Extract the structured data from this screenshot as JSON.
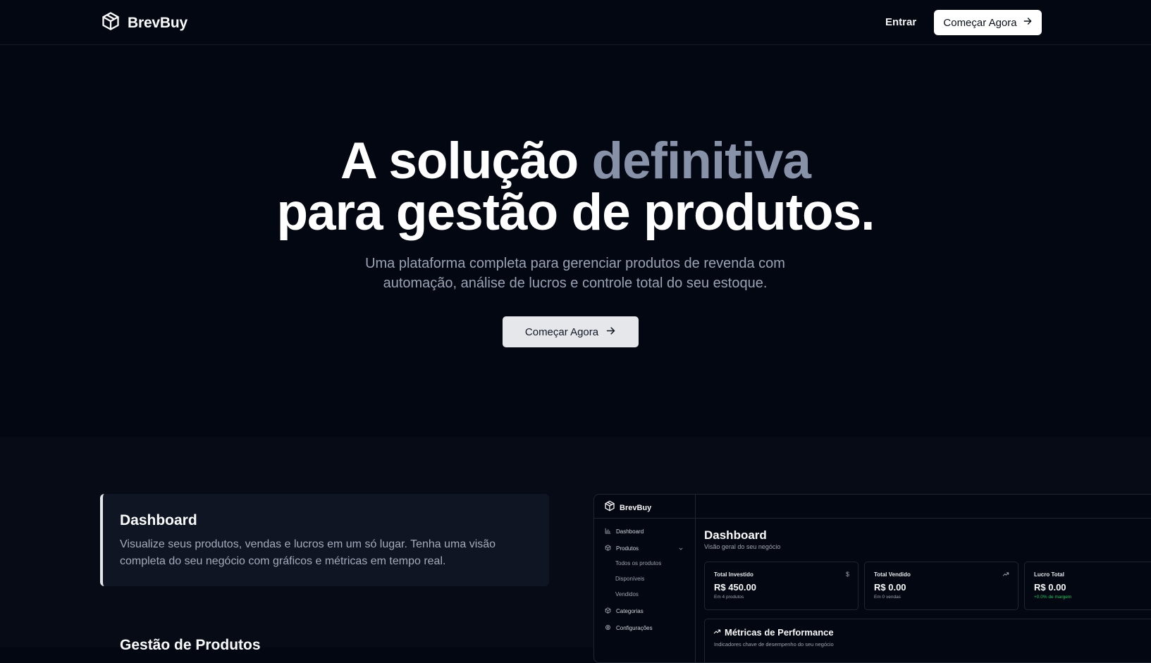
{
  "nav": {
    "brand": "BrevBuy",
    "login": "Entrar",
    "cta": "Começar Agora"
  },
  "hero": {
    "title_part1": "A solução ",
    "title_accent": "definitiva",
    "title_line2": "para gestão de produtos.",
    "subtitle": "Uma plataforma completa para gerenciar produtos de revenda com automação, análise de lucros e controle total do seu estoque.",
    "cta": "Começar Agora"
  },
  "features": {
    "active": {
      "title": "Dashboard",
      "description": "Visualize seus produtos, vendas e lucros em um só lugar. Tenha uma visão completa do seu negócio com gráficos e métricas em tempo real."
    },
    "next_title": "Gestão de Produtos"
  },
  "preview": {
    "brand": "BrevBuy",
    "sidebar": {
      "dashboard": "Dashboard",
      "produtos": "Produtos",
      "todos": "Todos os produtos",
      "disponiveis": "Disponíveis",
      "vendidos": "Vendidos",
      "categorias": "Categorias",
      "configuracoes": "Configurações"
    },
    "title": "Dashboard",
    "subtitle": "Visão geral do seu negócio",
    "cards": [
      {
        "label": "Total Investido",
        "value": "R$ 450.00",
        "note": "Em 4 produtos",
        "icon": "dollar-icon"
      },
      {
        "label": "Total Vendido",
        "value": "R$ 0.00",
        "note": "Em 0 vendas",
        "icon": "trending-up-icon"
      },
      {
        "label": "Lucro Total",
        "value": "R$ 0.00",
        "note": "+0.0% de margem",
        "icon": "none"
      }
    ],
    "metrics": {
      "title": "Métricas de Performance",
      "subtitle": "Indicadores chave de desempenho do seu negócio"
    }
  },
  "colors": {
    "background": "#030712",
    "accent_text": "#8791a8",
    "section_bg": "#070b16",
    "positive": "#22c55e"
  }
}
